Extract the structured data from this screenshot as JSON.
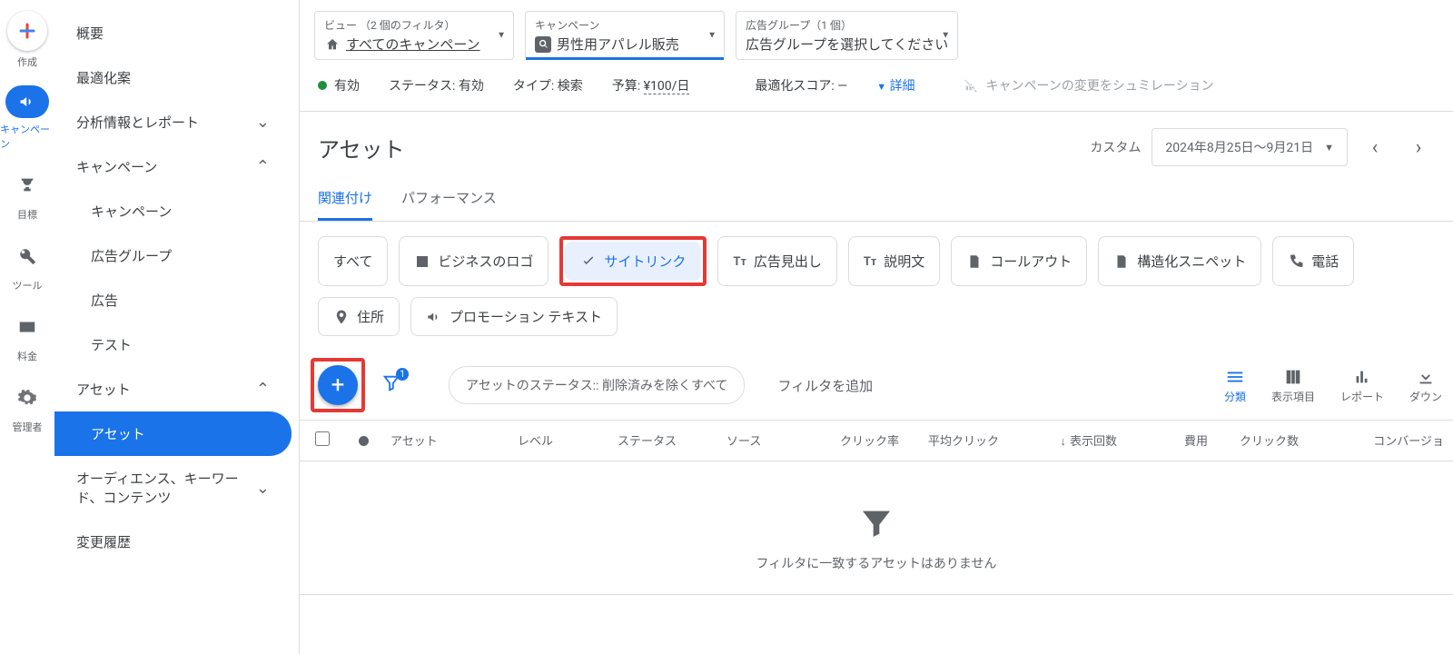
{
  "rail": [
    {
      "id": "create",
      "label": "作成",
      "icon": "plus-multicolor"
    },
    {
      "id": "campaigns",
      "label": "キャンペーン",
      "icon": "megaphone",
      "active": true
    },
    {
      "id": "goals",
      "label": "目標",
      "icon": "trophy"
    },
    {
      "id": "tools",
      "label": "ツール",
      "icon": "wrench"
    },
    {
      "id": "billing",
      "label": "料金",
      "icon": "card"
    },
    {
      "id": "admin",
      "label": "管理者",
      "icon": "gear"
    }
  ],
  "sidebar": {
    "items": [
      {
        "label": "概要"
      },
      {
        "label": "最適化案"
      },
      {
        "label": "分析情報とレポート",
        "chevron": "down"
      },
      {
        "label": "キャンペーン",
        "chevron": "up"
      },
      {
        "label": "キャンペーン",
        "sub": true
      },
      {
        "label": "広告グループ",
        "sub": true
      },
      {
        "label": "広告",
        "sub": true
      },
      {
        "label": "テスト",
        "sub": true
      },
      {
        "label": "アセット",
        "chevron": "up"
      },
      {
        "label": "アセット",
        "sub": true,
        "selected": true
      },
      {
        "label": "オーディエンス、キーワード、コンテンツ",
        "chevron": "down"
      },
      {
        "label": "変更履歴"
      }
    ]
  },
  "crumbs": [
    {
      "label": "ビュー （2 個のフィルタ）",
      "value": "すべてのキャンペーン",
      "icon": "home",
      "underline": true
    },
    {
      "label": "キャンペーン",
      "value": "男性用アパレル販売",
      "icon": "search-dark",
      "activeBar": true
    },
    {
      "label": "広告グループ（1 個）",
      "value": "広告グループを選択してください"
    }
  ],
  "status": {
    "enabled": "有効",
    "status_label": "ステータス:",
    "status_value": "有効",
    "type_label": "タイプ:",
    "type_value": "検索",
    "budget_label": "予算:",
    "budget_value": "¥100/日",
    "opt_label": "最適化スコア:",
    "opt_value": "—",
    "details": "詳細",
    "sim_disabled": "キャンペーンの変更をシュミレーション"
  },
  "page": {
    "title": "アセット",
    "date_label_prefix": "カスタム",
    "date_range": "2024年8月25日～9月21日"
  },
  "tabs": [
    {
      "label": "関連付け",
      "active": true
    },
    {
      "label": "パフォーマンス"
    }
  ],
  "chips": [
    {
      "label": "すべて",
      "icon": ""
    },
    {
      "label": "ビジネスのロゴ",
      "icon": "image"
    },
    {
      "label": "サイトリンク",
      "icon": "check",
      "selected": true,
      "highlight": true
    },
    {
      "label": "広告見出し",
      "icon": "tt"
    },
    {
      "label": "説明文",
      "icon": "tt"
    },
    {
      "label": "コールアウト",
      "icon": "doc"
    },
    {
      "label": "構造化スニペット",
      "icon": "doc"
    },
    {
      "label": "電話",
      "icon": "phone"
    },
    {
      "label": "住所",
      "icon": "pin"
    },
    {
      "label": "プロモーション テキスト",
      "icon": "megaphone"
    }
  ],
  "toolbar": {
    "filter_status": "アセットのステータス:: 削除済みを除くすべて",
    "add_filter": "フィルタを追加",
    "filter_badge": "1",
    "right": [
      {
        "label": "分類",
        "icon": "segment",
        "active": true
      },
      {
        "label": "表示項目",
        "icon": "columns"
      },
      {
        "label": "レポート",
        "icon": "chart"
      },
      {
        "label": "ダウン",
        "icon": "download"
      }
    ]
  },
  "table": {
    "columns": [
      "アセット",
      "レベル",
      "ステータス",
      "ソース",
      "クリック率",
      "平均クリック",
      "表示回数",
      "費用",
      "クリック数",
      "コンバージョ"
    ],
    "sort_col": "表示回数"
  },
  "empty_text": "フィルタに一致するアセットはありません"
}
